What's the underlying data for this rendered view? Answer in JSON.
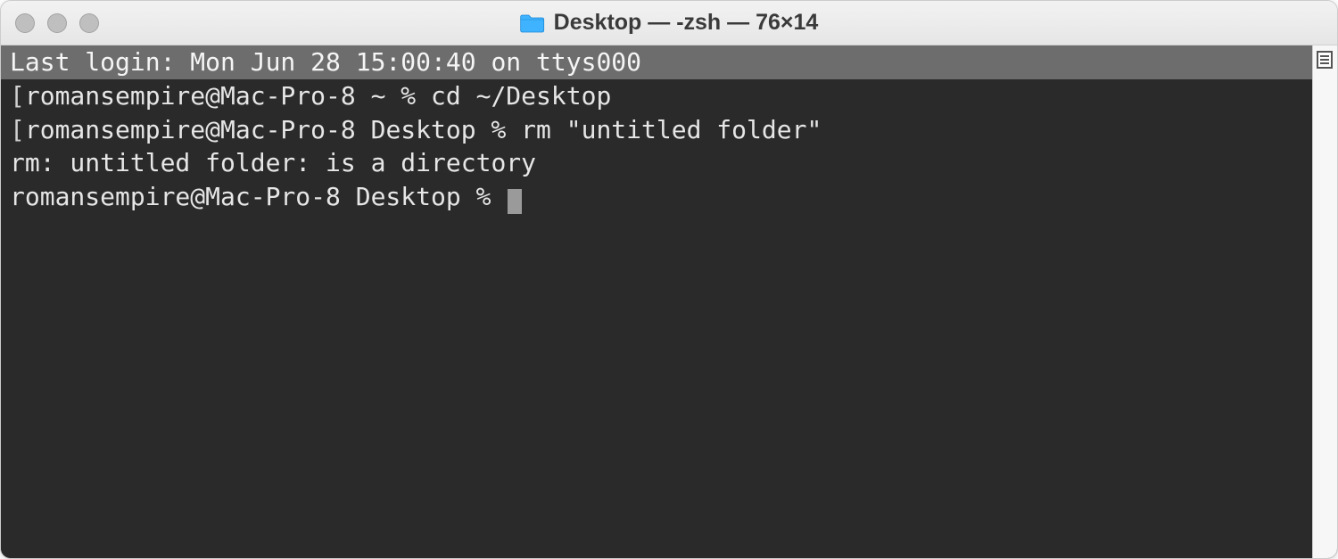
{
  "window": {
    "title": "Desktop — -zsh — 76×14"
  },
  "terminal": {
    "last_login": "Last login: Mon Jun 28 15:00:40 on ttys000",
    "lines": [
      {
        "prompt": "romansempire@Mac-Pro-8 ~ % ",
        "cmd": "cd ~/Desktop"
      },
      {
        "prompt": "romansempire@Mac-Pro-8 Desktop % ",
        "cmd": "rm \"untitled folder\""
      }
    ],
    "error": "rm: untitled folder: is a directory",
    "current_prompt": "romansempire@Mac-Pro-8 Desktop % "
  }
}
